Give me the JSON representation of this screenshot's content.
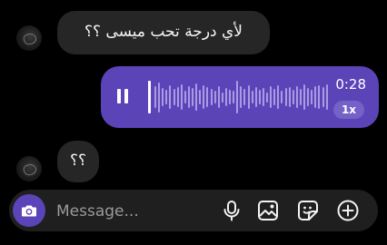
{
  "messages": [
    {
      "text": "لأي درجة تحب ميسى ؟؟"
    },
    {
      "text": "؟؟"
    }
  ],
  "voice_note": {
    "duration": "0:28",
    "speed": "1x",
    "progress": 0.0,
    "bar_heights": [
      0.55,
      0.75,
      0.45,
      0.35,
      0.6,
      0.4,
      0.5,
      0.65,
      0.3,
      0.55,
      0.45,
      0.7,
      0.35,
      0.6,
      0.5,
      0.4,
      0.3,
      0.55,
      0.25,
      0.45,
      0.35,
      0.3,
      0.8,
      0.55,
      0.4,
      0.6,
      0.3,
      0.5,
      0.35,
      0.45,
      0.25,
      0.55,
      0.4,
      0.6,
      0.3,
      0.45,
      0.5,
      0.35,
      0.55,
      0.4,
      0.65,
      0.45,
      0.35,
      0.55,
      0.6,
      0.5,
      0.65
    ]
  },
  "composer": {
    "placeholder": "Message..."
  },
  "colors": {
    "accent": "#5b44b8",
    "incoming_bubble": "#262626",
    "background": "#000000"
  }
}
